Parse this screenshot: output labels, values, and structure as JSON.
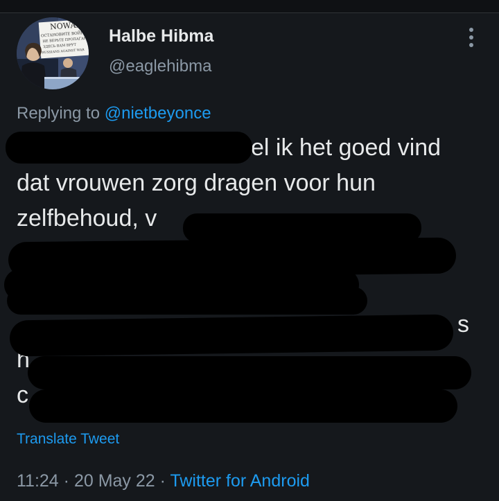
{
  "user": {
    "display_name": "Halbe Hibma",
    "handle": "@eaglehibma",
    "avatar_sign_lines": [
      "NOWAR",
      "ОСТАНОВИТЕ ВОЙНУ",
      "НЕ ВЕРЬТЕ ПРОПАГАНДЕ",
      "ЗДЕСЬ ВАМ ВРУТ",
      "RUSSIANS AGAINST WAR"
    ]
  },
  "reply": {
    "prefix": "Replying to ",
    "mention": "@nietbeyonce"
  },
  "tweet": {
    "lines": [
      {
        "visible_right": "el ik het goed vind"
      },
      {
        "text": "dat vrouwen zorg dragen voor hun"
      },
      {
        "text": "zelfbehoud, v"
      },
      {
        "text": ""
      },
      {
        "text": ""
      },
      {
        "visible_right": "s"
      },
      {
        "text": "h"
      },
      {
        "text": "c"
      }
    ]
  },
  "translate_label": "Translate Tweet",
  "meta": {
    "time": "11:24",
    "sep1": " · ",
    "date": "20 May 22",
    "sep2": " · ",
    "source": "Twitter for Android"
  },
  "colors": {
    "background": "#15181c",
    "text": "#e7e9ea",
    "secondary": "#8b98a5",
    "accent": "#1d9bf0",
    "redaction": "#000000"
  },
  "icons": {
    "more": "more-vertical-icon"
  }
}
